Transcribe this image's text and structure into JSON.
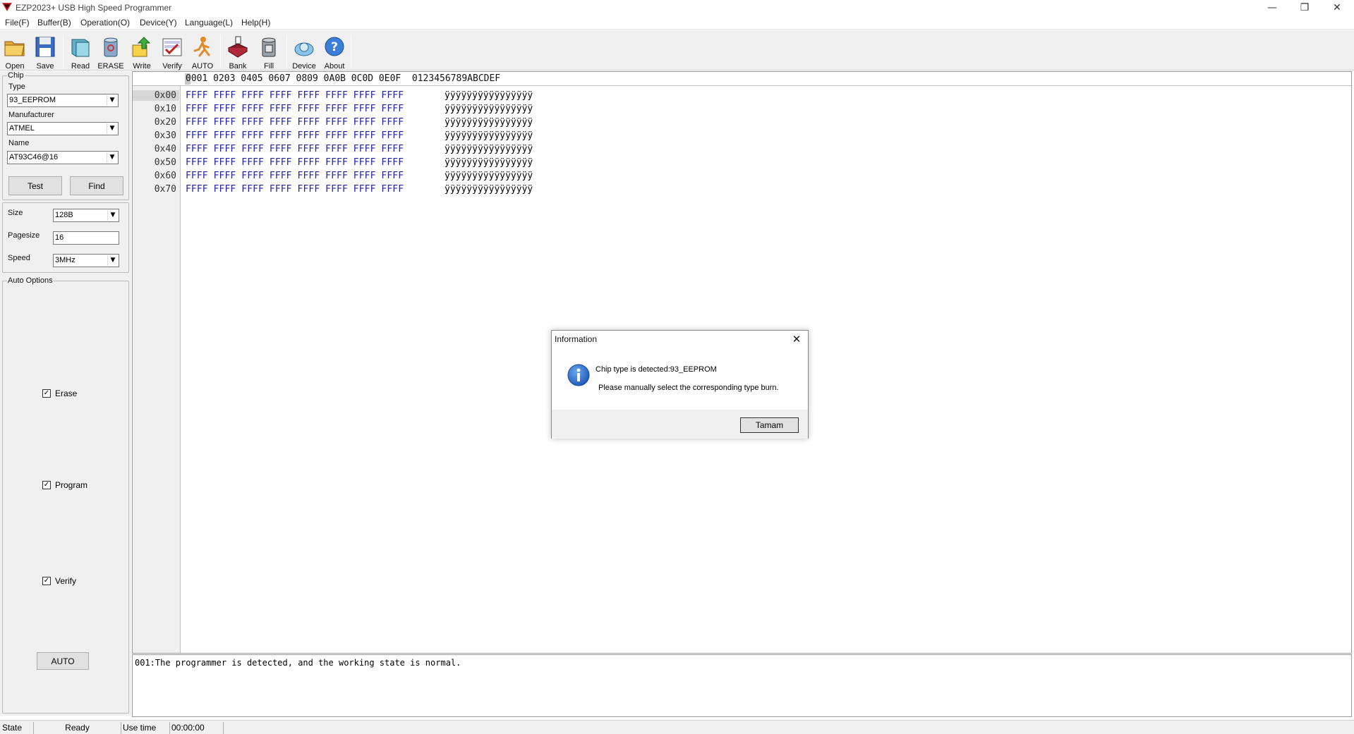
{
  "window": {
    "title": "EZP2023+ USB High Speed Programmer",
    "controls": {
      "minimize": "—",
      "restore": "❐",
      "close": "✕"
    }
  },
  "menu": [
    "File(F)",
    "Buffer(B)",
    "Operation(O)",
    "Device(Y)",
    "Language(L)",
    "Help(H)"
  ],
  "toolbar": {
    "open": "Open",
    "save": "Save",
    "read": "Read",
    "erase": "ERASE",
    "write": "Write",
    "verify": "Verify",
    "auto": "AUTO",
    "bank": "Bank",
    "fill": "Fill",
    "device": "Device",
    "about": "About"
  },
  "chip": {
    "group_label": "Chip",
    "type_label": "Type",
    "type_value": "93_EEPROM",
    "manufacturer_label": "Manufacturer",
    "manufacturer_value": "ATMEL",
    "name_label": "Name",
    "name_value": "AT93C46@16",
    "test_button": "Test",
    "find_button": "Find"
  },
  "params": {
    "size_label": "Size",
    "size_value": "128B",
    "pagesize_label": "Pagesize",
    "pagesize_value": "16",
    "speed_label": "Speed",
    "speed_value": "3MHz"
  },
  "auto_options": {
    "group_label": "Auto Options",
    "erase": {
      "label": "Erase",
      "checked": true
    },
    "program": {
      "label": "Program",
      "checked": true
    },
    "verify": {
      "label": "Verify",
      "checked": true
    },
    "auto_button": "AUTO"
  },
  "hex_view": {
    "header": "0001 0203 0405 0607 0809 0A0B 0C0D 0E0F  0123456789ABCDEF",
    "rows": [
      {
        "addr": "0x00",
        "bytes": "FFFF FFFF FFFF FFFF FFFF FFFF FFFF FFFF",
        "ascii": "ÿÿÿÿÿÿÿÿÿÿÿÿÿÿÿÿ"
      },
      {
        "addr": "0x10",
        "bytes": "FFFF FFFF FFFF FFFF FFFF FFFF FFFF FFFF",
        "ascii": "ÿÿÿÿÿÿÿÿÿÿÿÿÿÿÿÿ"
      },
      {
        "addr": "0x20",
        "bytes": "FFFF FFFF FFFF FFFF FFFF FFFF FFFF FFFF",
        "ascii": "ÿÿÿÿÿÿÿÿÿÿÿÿÿÿÿÿ"
      },
      {
        "addr": "0x30",
        "bytes": "FFFF FFFF FFFF FFFF FFFF FFFF FFFF FFFF",
        "ascii": "ÿÿÿÿÿÿÿÿÿÿÿÿÿÿÿÿ"
      },
      {
        "addr": "0x40",
        "bytes": "FFFF FFFF FFFF FFFF FFFF FFFF FFFF FFFF",
        "ascii": "ÿÿÿÿÿÿÿÿÿÿÿÿÿÿÿÿ"
      },
      {
        "addr": "0x50",
        "bytes": "FFFF FFFF FFFF FFFF FFFF FFFF FFFF FFFF",
        "ascii": "ÿÿÿÿÿÿÿÿÿÿÿÿÿÿÿÿ"
      },
      {
        "addr": "0x60",
        "bytes": "FFFF FFFF FFFF FFFF FFFF FFFF FFFF FFFF",
        "ascii": "ÿÿÿÿÿÿÿÿÿÿÿÿÿÿÿÿ"
      },
      {
        "addr": "0x70",
        "bytes": "FFFF FFFF FFFF FFFF FFFF FFFF FFFF FFFF",
        "ascii": "ÿÿÿÿÿÿÿÿÿÿÿÿÿÿÿÿ"
      }
    ]
  },
  "log": {
    "line1": "001:The programmer is detected, and the working state is normal."
  },
  "status": {
    "state_label": "State",
    "state_value": "Ready",
    "usetime_label": "Use time",
    "usetime_value": "00:00:00"
  },
  "dialog": {
    "title": "Information",
    "message1": "Chip type is detected:93_EEPROM",
    "message2": "Please manually select the corresponding type burn.",
    "ok_button": "Tamam",
    "close": "✕"
  }
}
